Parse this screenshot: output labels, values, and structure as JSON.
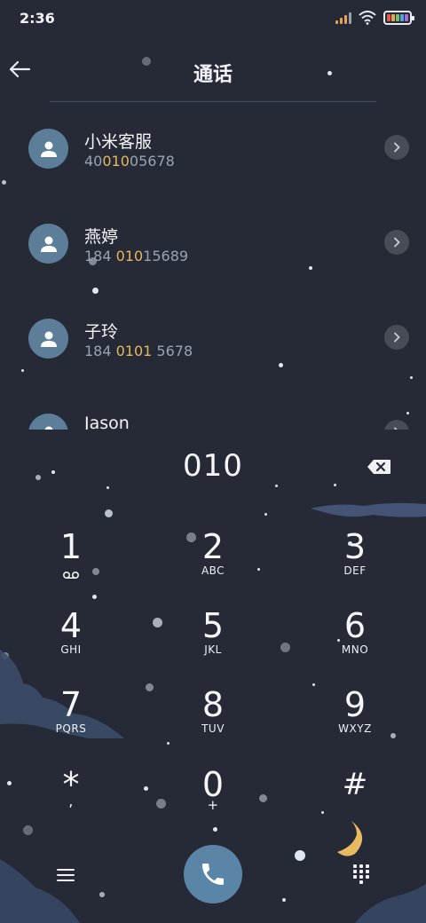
{
  "status_bar": {
    "time": "2:36",
    "icons": [
      "signal-icon",
      "wifi-icon",
      "battery-icon"
    ]
  },
  "header": {
    "title": "通话",
    "back_icon": "arrow-left-icon"
  },
  "contacts": [
    {
      "name": "小米客服",
      "number_before": "40",
      "number_match": "010",
      "number_after": "05678",
      "icon": "person-icon"
    },
    {
      "name": "燕婷",
      "number_before": "184 ",
      "number_match": "010",
      "number_after": "15689",
      "icon": "person-icon"
    },
    {
      "name": "子玲",
      "number_before": "184 ",
      "number_match": "0101",
      "number_after": " 5678",
      "icon": "person-icon"
    },
    {
      "name": "Jason",
      "number_before": "",
      "number_match": "",
      "number_after": "",
      "icon": "person-icon"
    }
  ],
  "dialpad": {
    "input": "010",
    "backspace_icon": "backspace-icon",
    "keys": [
      {
        "digit": "1",
        "letters": "",
        "icon": "voicemail-icon"
      },
      {
        "digit": "2",
        "letters": "ABC"
      },
      {
        "digit": "3",
        "letters": "DEF"
      },
      {
        "digit": "4",
        "letters": "GHI"
      },
      {
        "digit": "5",
        "letters": "JKL"
      },
      {
        "digit": "6",
        "letters": "MNO"
      },
      {
        "digit": "7",
        "letters": "PQRS"
      },
      {
        "digit": "8",
        "letters": "TUV"
      },
      {
        "digit": "9",
        "letters": "WXYZ"
      },
      {
        "digit": "*",
        "letters": ","
      },
      {
        "digit": "0",
        "letters": "+"
      },
      {
        "digit": "#",
        "letters": ""
      }
    ]
  },
  "bottom_bar": {
    "menu_icon": "menu-icon",
    "call_icon": "phone-icon",
    "keypad_icon": "dialpad-icon"
  },
  "colors": {
    "background": "#252a36",
    "accent": "#5a85a6",
    "match_highlight": "#e6b85c",
    "secondary_text": "#9aa3b1"
  }
}
